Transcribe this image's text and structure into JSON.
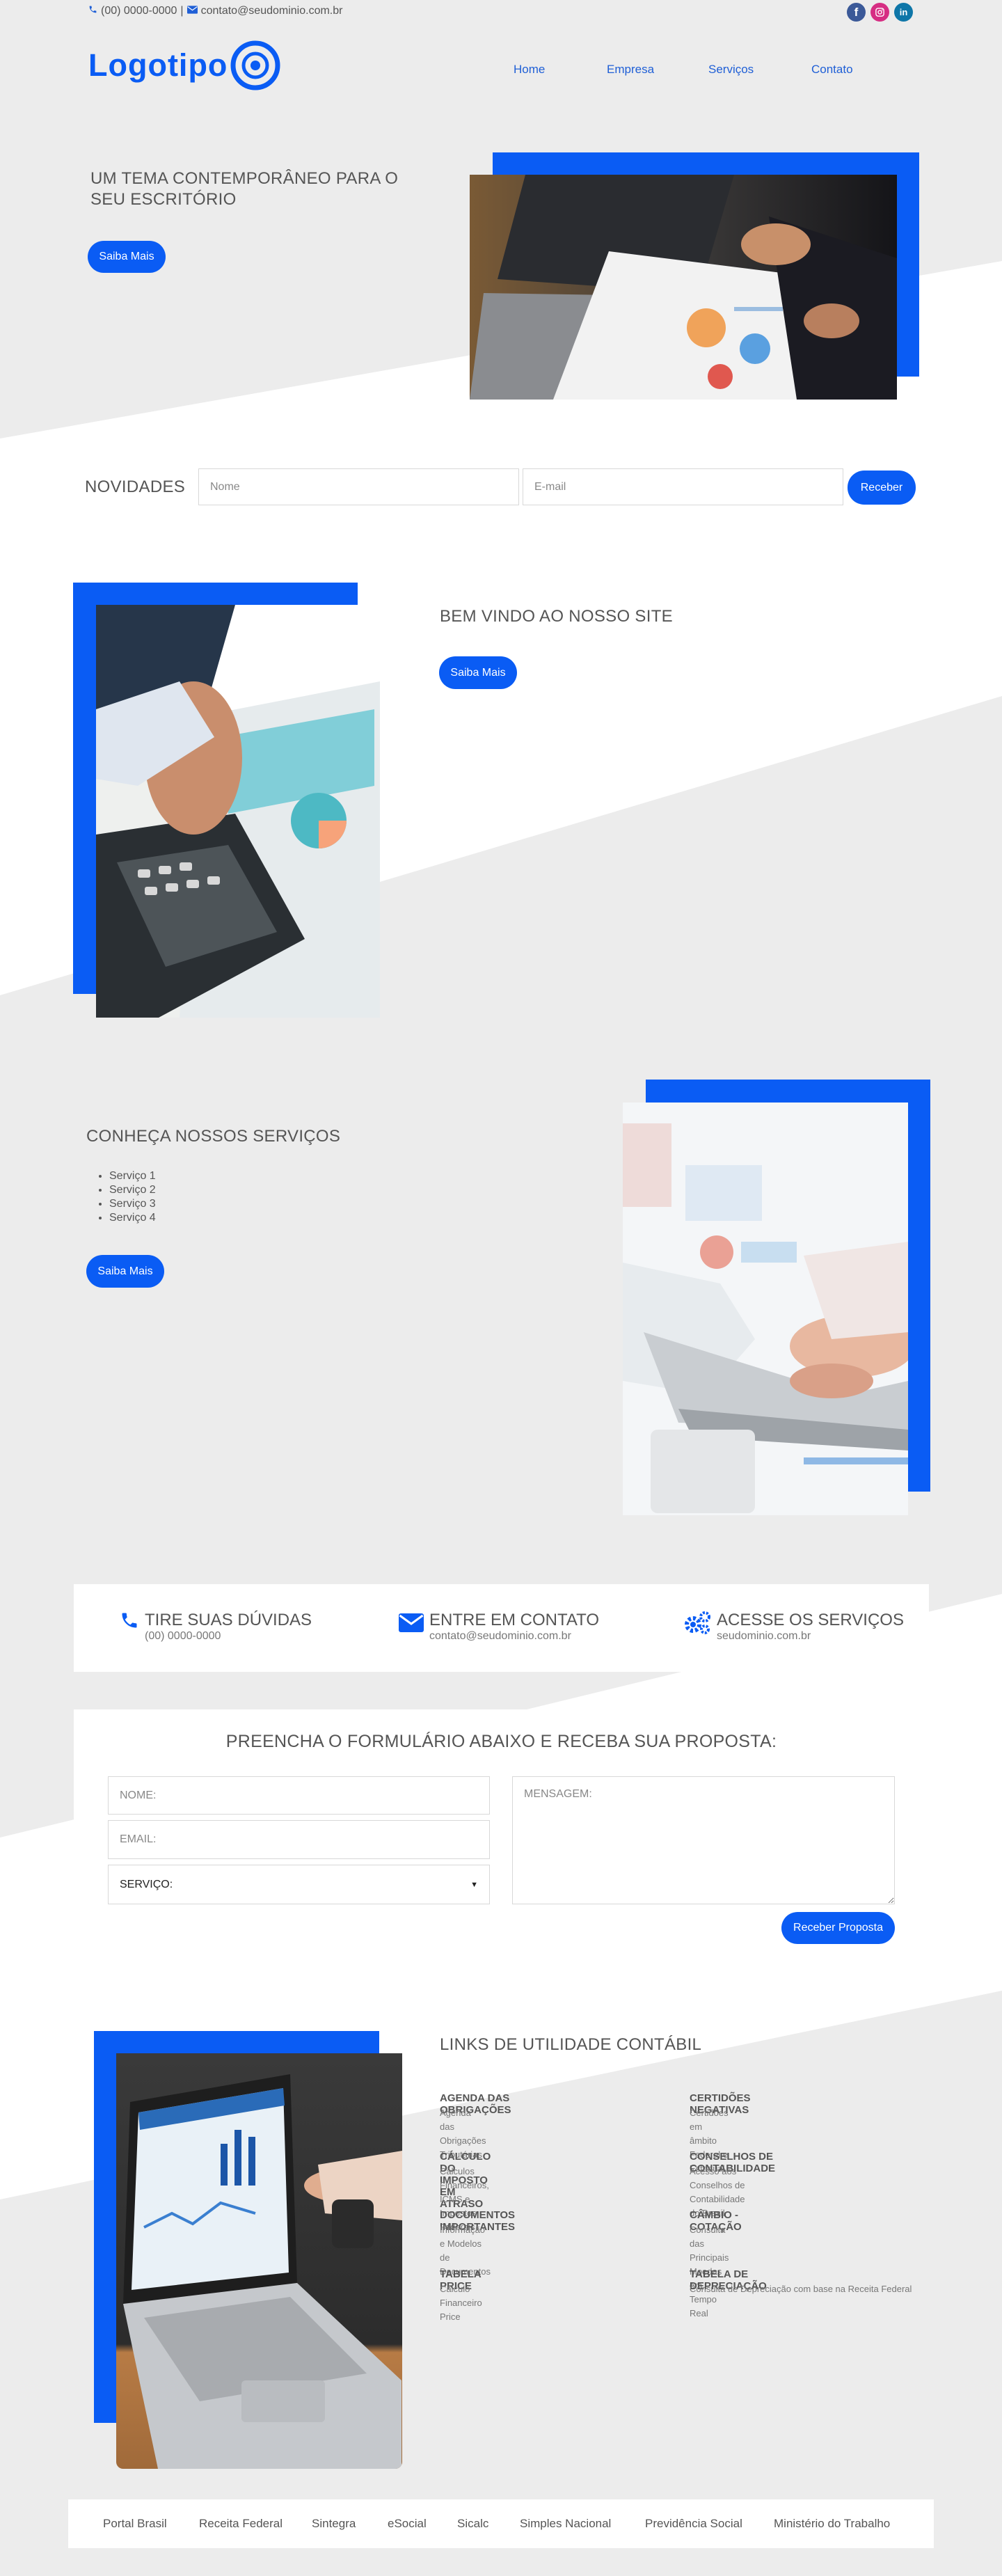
{
  "topbar": {
    "phone": "(00) 0000-0000",
    "separator": "|",
    "email": "contato@seudominio.com.br"
  },
  "social": [
    "facebook-icon",
    "instagram-icon",
    "linkedin-icon"
  ],
  "brand": {
    "logo_text": "Logotipo",
    "accent": "#0a5cf4"
  },
  "nav": {
    "items": [
      "Home",
      "Empresa",
      "Serviços",
      "Contato"
    ]
  },
  "hero": {
    "title": "UM TEMA CONTEMPORÂNEO PARA O SEU ESCRITÓRIO",
    "button": "Saiba Mais"
  },
  "newsletter": {
    "title": "NOVIDADES",
    "name_placeholder": "Nome",
    "email_placeholder": "E-mail",
    "button": "Receber"
  },
  "welcome": {
    "title": "BEM VINDO AO NOSSO SITE",
    "button": "Saiba Mais"
  },
  "services": {
    "title": "CONHEÇA NOSSOS SERVIÇOS",
    "items": [
      "Serviço 1",
      "Serviço 2",
      "Serviço 3",
      "Serviço 4"
    ],
    "button": "Saiba Mais"
  },
  "info": [
    {
      "icon": "phone-icon",
      "title": "TIRE SUAS DÚVIDAS",
      "sub": "(00) 0000-0000"
    },
    {
      "icon": "envelope-icon",
      "title": "ENTRE EM CONTATO",
      "sub": "contato@seudominio.com.br"
    },
    {
      "icon": "gears-icon",
      "title": "ACESSE OS SERVIÇOS",
      "sub": "seudominio.com.br"
    }
  ],
  "form": {
    "title": "PREENCHA O FORMULÁRIO ABAIXO E RECEBA SUA PROPOSTA:",
    "name_placeholder": "NOME:",
    "email_placeholder": "EMAIL:",
    "service_selected": "SERVIÇO:",
    "message_placeholder": "MENSAGEM:",
    "button": "Receber Proposta"
  },
  "links": {
    "title": "LINKS DE UTILIDADE CONTÁBIL",
    "items": [
      {
        "title": "AGENDA DAS OBRIGAÇÕES",
        "sub": "Agenda das Obrigações Tributárias"
      },
      {
        "title": "CERTIDÕES NEGATIVAS",
        "sub": "Certidões em âmbito Federal e Estadual"
      },
      {
        "title": "CÁLCULO DO IMPOSTO EM ATRASO",
        "sub": "Cálculos Financeiros, ICMS e Impostos Federais"
      },
      {
        "title": "CONSELHOS DE CONTABILIDADE",
        "sub": "Acesso aos Conselhos de Contabilidade do Brasil"
      },
      {
        "title": "DOCUMENTOS IMPORTANTES",
        "sub": "Informação e Modelos de Documentos"
      },
      {
        "title": "CÂMBIO - COTAÇÃO",
        "sub": "Consulta das Principais Moedas em Tempo Real"
      },
      {
        "title": "TABELA PRICE",
        "sub": "Cálculo Financeiro Price"
      },
      {
        "title": "TABELA DE DEPRECIAÇÃO",
        "sub": "Consulta de Depreciação com base na Receita Federal"
      }
    ]
  },
  "footer": {
    "links": [
      "Portal Brasil",
      "Receita Federal",
      "Sintegra",
      "eSocial",
      "Sicalc",
      "Simples Nacional",
      "Previdência Social",
      "Ministério do Trabalho"
    ]
  }
}
